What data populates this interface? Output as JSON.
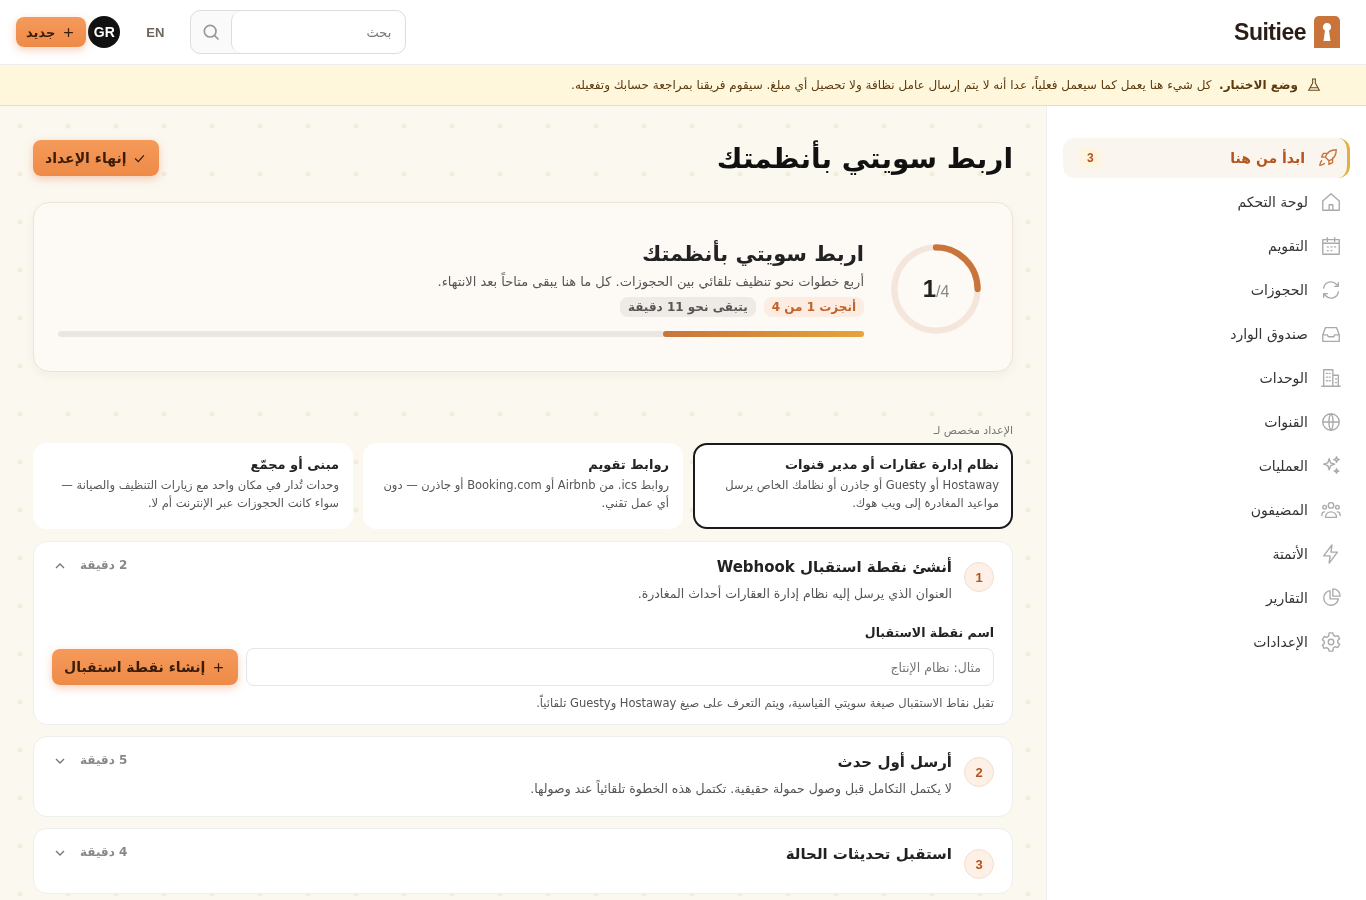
{
  "header": {
    "brand": "Suitiee",
    "search": {
      "placeholder": "بحث"
    },
    "language": "EN",
    "avatar": "GR",
    "new_button": "جديد"
  },
  "banner": {
    "text": "**وضع الاختبار.**  كل شيء هنا يعمل كما سيعمل فعلياً، عدا أنه لا يتم إرسال عامل نظافة ولا تحصيل أي مبلغ. سيقوم فريقنا بمراجعة حسابك وتفعيله."
  },
  "sidebar": {
    "items": [
      {
        "label": "ابدأ من هنا",
        "selected": true,
        "badge": "3"
      },
      {
        "label": "لوحة التحكم",
        "selected": false
      },
      {
        "label": "التقويم",
        "selected": false
      },
      {
        "label": "الحجوزات",
        "selected": false
      },
      {
        "label": "صندوق الوارد",
        "selected": false
      },
      {
        "label": "الوحدات",
        "selected": false
      },
      {
        "label": "القنوات",
        "selected": false
      },
      {
        "label": "العمليات",
        "selected": false
      },
      {
        "label": "المضيفون",
        "selected": false
      },
      {
        "label": "الأتمتة",
        "selected": false
      },
      {
        "label": "التقارير",
        "selected": false
      },
      {
        "label": "الإعدادات",
        "selected": false
      }
    ]
  },
  "page": {
    "title": "اربط سويتي بأنظمتك",
    "finish_button": "إنهاء الإعداد"
  },
  "progress": {
    "title": "اربط سويتي بأنظمتك",
    "description": "أربع خطوات نحو تنظيف تلقائي بين الحجوزات. كل ما هنا يبقى متاحاً بعد الانتهاء.",
    "done_badge": "أنجزت 1 من 4",
    "remaining_badge": "يتبقى نحو 11 دقيقة",
    "ring_count": "1",
    "ring_total": "/4",
    "level": 0.25
  },
  "setup_for": {
    "label": "الإعداد مخصص لـ",
    "options": [
      {
        "title": "نظام إدارة عقارات أو مدير قنوات",
        "description": "Hostaway أو Guesty أو جاذرن أو نظامك الخاص يرسل مواعيد المغادرة إلى ويب هوك.",
        "selected": true
      },
      {
        "title": "روابط تقويم",
        "description": "روابط ics. من Airbnb أو Booking.com أو جاذرن — دون أي عمل تقني.",
        "selected": false
      },
      {
        "title": "مبنى أو مجمّع",
        "description": "وحدات تُدار في مكان واحد مع زيارات التنظيف والصيانة — سواء كانت الحجوزات عبر الإنترنت أم لا.",
        "selected": false
      }
    ]
  },
  "steps": [
    {
      "number": "1",
      "title": "أنشئ نقطة استقبال Webhook",
      "description": "العنوان الذي يرسل إليه نظام إدارة العقارات أحداث المغادرة.",
      "duration": "2 دقيقة",
      "expanded": true,
      "field_label": "اسم نقطة الاستقبال",
      "placeholder": "مثال: نظام الإنتاج",
      "button": "إنشاء نقطة استقبال",
      "hint": "تقبل نقاط الاستقبال صيغة سويتي القياسية، ويتم التعرف على صيغ Hostaway وGuesty تلقائياً."
    },
    {
      "number": "2",
      "title": "أرسل أول حدث",
      "description": "لا يكتمل التكامل قبل وصول حمولة حقيقية. تكتمل هذه الخطوة تلقائياً عند وصولها.",
      "duration": "5 دقيقة",
      "expanded": false
    },
    {
      "number": "3",
      "title": "استقبل تحديثات الحالة",
      "duration": "4 دقيقة",
      "expanded": false
    }
  ]
}
